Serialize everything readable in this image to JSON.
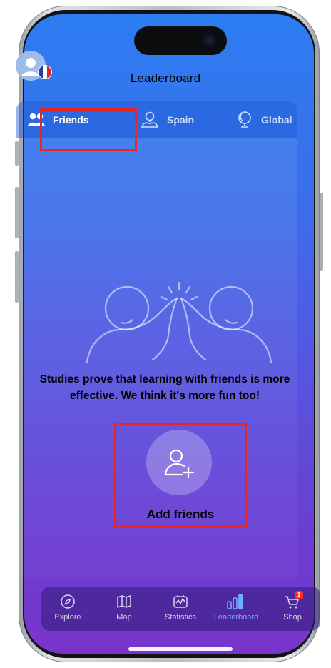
{
  "header": {
    "title": "Leaderboard"
  },
  "tabs": [
    {
      "label": "Friends",
      "icon": "friends-icon",
      "active": true
    },
    {
      "label": "Spain",
      "icon": "region-pin-icon",
      "active": false
    },
    {
      "label": "Global",
      "icon": "globe-icon",
      "active": false
    }
  ],
  "main": {
    "message": "Studies prove that learning with friends is more effective. We think it's more fun too!",
    "add_friends_label": "Add friends"
  },
  "bottom_nav": [
    {
      "label": "Explore",
      "icon": "compass-icon",
      "active": false
    },
    {
      "label": "Map",
      "icon": "map-icon",
      "active": false
    },
    {
      "label": "Statistics",
      "icon": "statistics-icon",
      "active": false
    },
    {
      "label": "Leaderboard",
      "icon": "leaderboard-icon",
      "active": true
    },
    {
      "label": "Shop",
      "icon": "cart-icon",
      "active": false,
      "badge": "1"
    }
  ],
  "colors": {
    "highlight": "#e8251f",
    "active_nav": "#6fb0ff",
    "gradient_top": "#2c7df2",
    "gradient_bottom": "#7a34c9"
  }
}
